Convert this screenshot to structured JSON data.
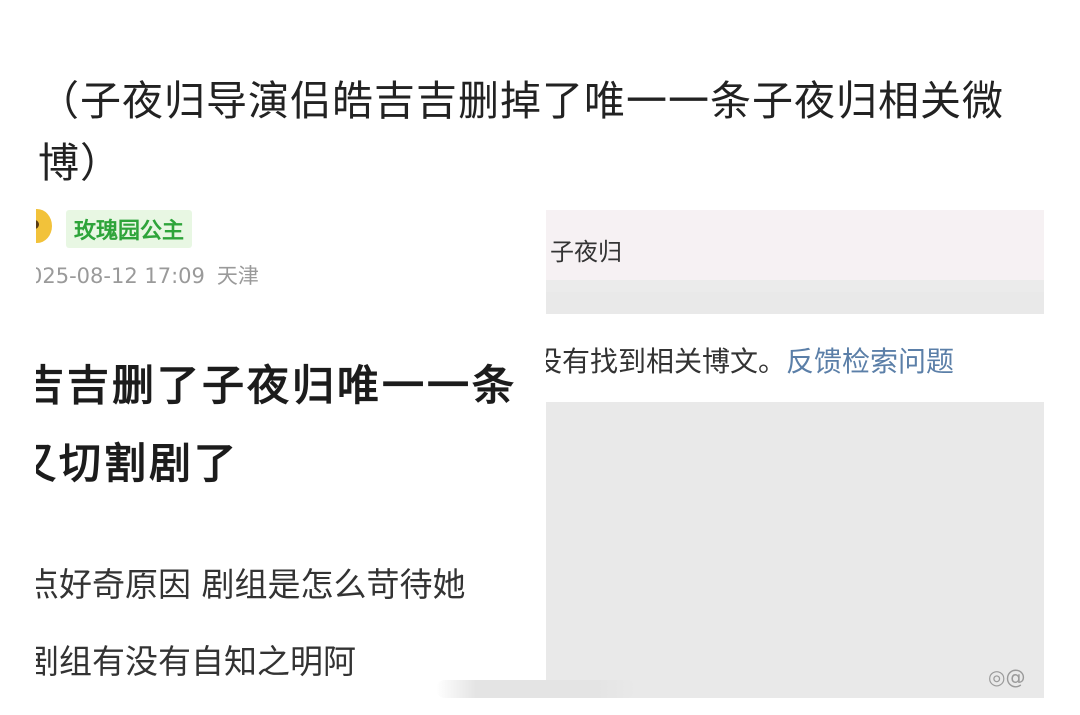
{
  "caption": "（子夜归导演侣皓吉吉删掉了唯一一条子夜归相关微博）",
  "left_post": {
    "username": "玫瑰园公主",
    "timestamp": "025-08-12 17:09",
    "location": "天津",
    "line1": "吉吉删了子夜归唯一一条",
    "line2": "又切割剧了",
    "body1": "点好奇原因 剧组是怎么苛待她",
    "body2": "剧组有没有自知之明阿"
  },
  "right_search": {
    "query": "子夜归",
    "no_result_text": "没有找到相关博文。",
    "feedback_link": "反馈检索问题"
  },
  "watermark": "@"
}
